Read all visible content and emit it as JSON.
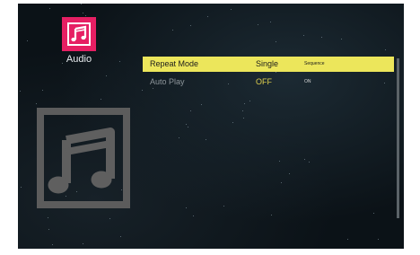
{
  "category": {
    "label": "Audio",
    "icon": "music-note-icon",
    "accent": "#e61f63"
  },
  "thumbnail": {
    "icon": "music-note-icon"
  },
  "settings": [
    {
      "name": "Repeat Mode",
      "value": "Single",
      "option": "Sequence",
      "selected": true
    },
    {
      "name": "Auto Play",
      "value": "OFF",
      "option": "ON",
      "selected": false
    }
  ],
  "colors": {
    "highlight": "#ece65b",
    "value_text": "#e2d24d"
  }
}
